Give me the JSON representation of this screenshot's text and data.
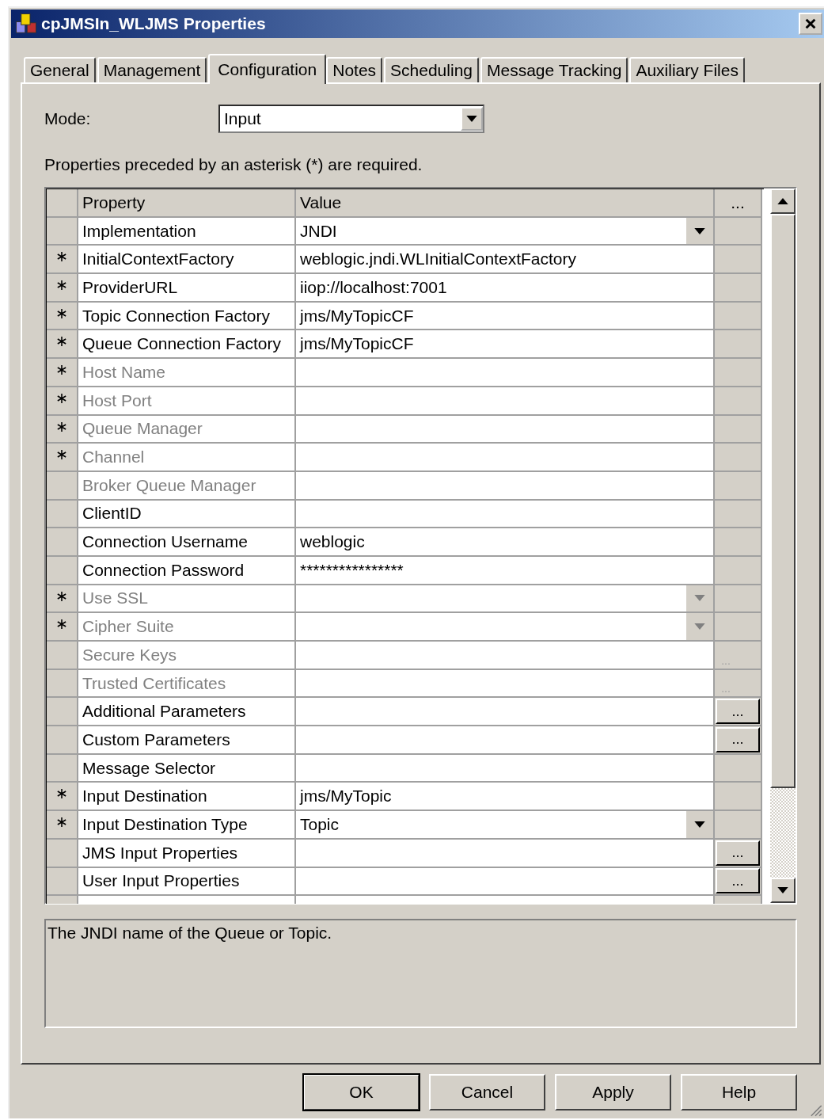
{
  "window": {
    "title": "cpJMSIn_WLJMS Properties"
  },
  "tabs": [
    {
      "label": "General",
      "selected": false
    },
    {
      "label": "Management",
      "selected": false
    },
    {
      "label": "Configuration",
      "selected": true
    },
    {
      "label": "Notes",
      "selected": false
    },
    {
      "label": "Scheduling",
      "selected": false
    },
    {
      "label": "Message Tracking",
      "selected": false
    },
    {
      "label": "Auxiliary Files",
      "selected": false
    }
  ],
  "mode": {
    "label": "Mode:",
    "value": "Input"
  },
  "note": "Properties preceded by an asterisk (*) are required.",
  "grid": {
    "columns": [
      "Property",
      "Value",
      "..."
    ],
    "rows": [
      {
        "required": false,
        "property": "Implementation",
        "value": "JNDI",
        "disabled": false,
        "kind": "dropdown"
      },
      {
        "required": true,
        "property": "InitialContextFactory",
        "value": "weblogic.jndi.WLInitialContextFactory",
        "disabled": false,
        "kind": "text"
      },
      {
        "required": true,
        "property": "ProviderURL",
        "value": "iiop://localhost:7001",
        "disabled": false,
        "kind": "text"
      },
      {
        "required": true,
        "property": "Topic Connection Factory",
        "value": "jms/MyTopicCF",
        "disabled": false,
        "kind": "text"
      },
      {
        "required": true,
        "property": "Queue Connection Factory",
        "value": "jms/MyTopicCF",
        "disabled": false,
        "kind": "text"
      },
      {
        "required": true,
        "property": "Host Name",
        "disabled": true,
        "kind": "text"
      },
      {
        "required": true,
        "property": "Host Port",
        "disabled": true,
        "kind": "text"
      },
      {
        "required": true,
        "property": "Queue Manager",
        "disabled": true,
        "kind": "text"
      },
      {
        "required": true,
        "property": "Channel",
        "disabled": true,
        "kind": "text"
      },
      {
        "required": false,
        "property": "Broker Queue Manager",
        "disabled": true,
        "kind": "text"
      },
      {
        "required": false,
        "property": "ClientID",
        "disabled": false,
        "kind": "text"
      },
      {
        "required": false,
        "property": "Connection Username",
        "value": "weblogic",
        "disabled": false,
        "kind": "text"
      },
      {
        "required": false,
        "property": "Connection Password",
        "value": "****************",
        "disabled": false,
        "kind": "text"
      },
      {
        "required": true,
        "property": "Use SSL",
        "disabled": true,
        "kind": "dropdown"
      },
      {
        "required": true,
        "property": "Cipher Suite",
        "disabled": true,
        "kind": "dropdown"
      },
      {
        "required": false,
        "property": "Secure Keys",
        "disabled": true,
        "kind": "ellipsis",
        "action": "..."
      },
      {
        "required": false,
        "property": "Trusted Certificates",
        "disabled": true,
        "kind": "ellipsis",
        "action": "..."
      },
      {
        "required": false,
        "property": "Additional Parameters",
        "disabled": false,
        "kind": "ellipsis",
        "action": "..."
      },
      {
        "required": false,
        "property": "Custom Parameters",
        "disabled": false,
        "kind": "ellipsis",
        "action": "..."
      },
      {
        "required": false,
        "property": "Message Selector",
        "disabled": false,
        "kind": "text"
      },
      {
        "required": true,
        "property": "Input Destination",
        "value": "jms/MyTopic",
        "disabled": false,
        "kind": "text"
      },
      {
        "required": true,
        "property": "Input Destination Type",
        "value": "Topic",
        "disabled": false,
        "kind": "dropdown"
      },
      {
        "required": false,
        "property": "JMS Input Properties",
        "disabled": false,
        "kind": "ellipsis",
        "action": "..."
      },
      {
        "required": false,
        "property": "User Input Properties",
        "disabled": false,
        "kind": "ellipsis",
        "action": "..."
      }
    ]
  },
  "description": "The JNDI name of the Queue or Topic.",
  "buttons": [
    {
      "label": "OK",
      "default": true
    },
    {
      "label": "Cancel",
      "default": false
    },
    {
      "label": "Apply",
      "default": false
    },
    {
      "label": "Help",
      "default": false
    }
  ]
}
